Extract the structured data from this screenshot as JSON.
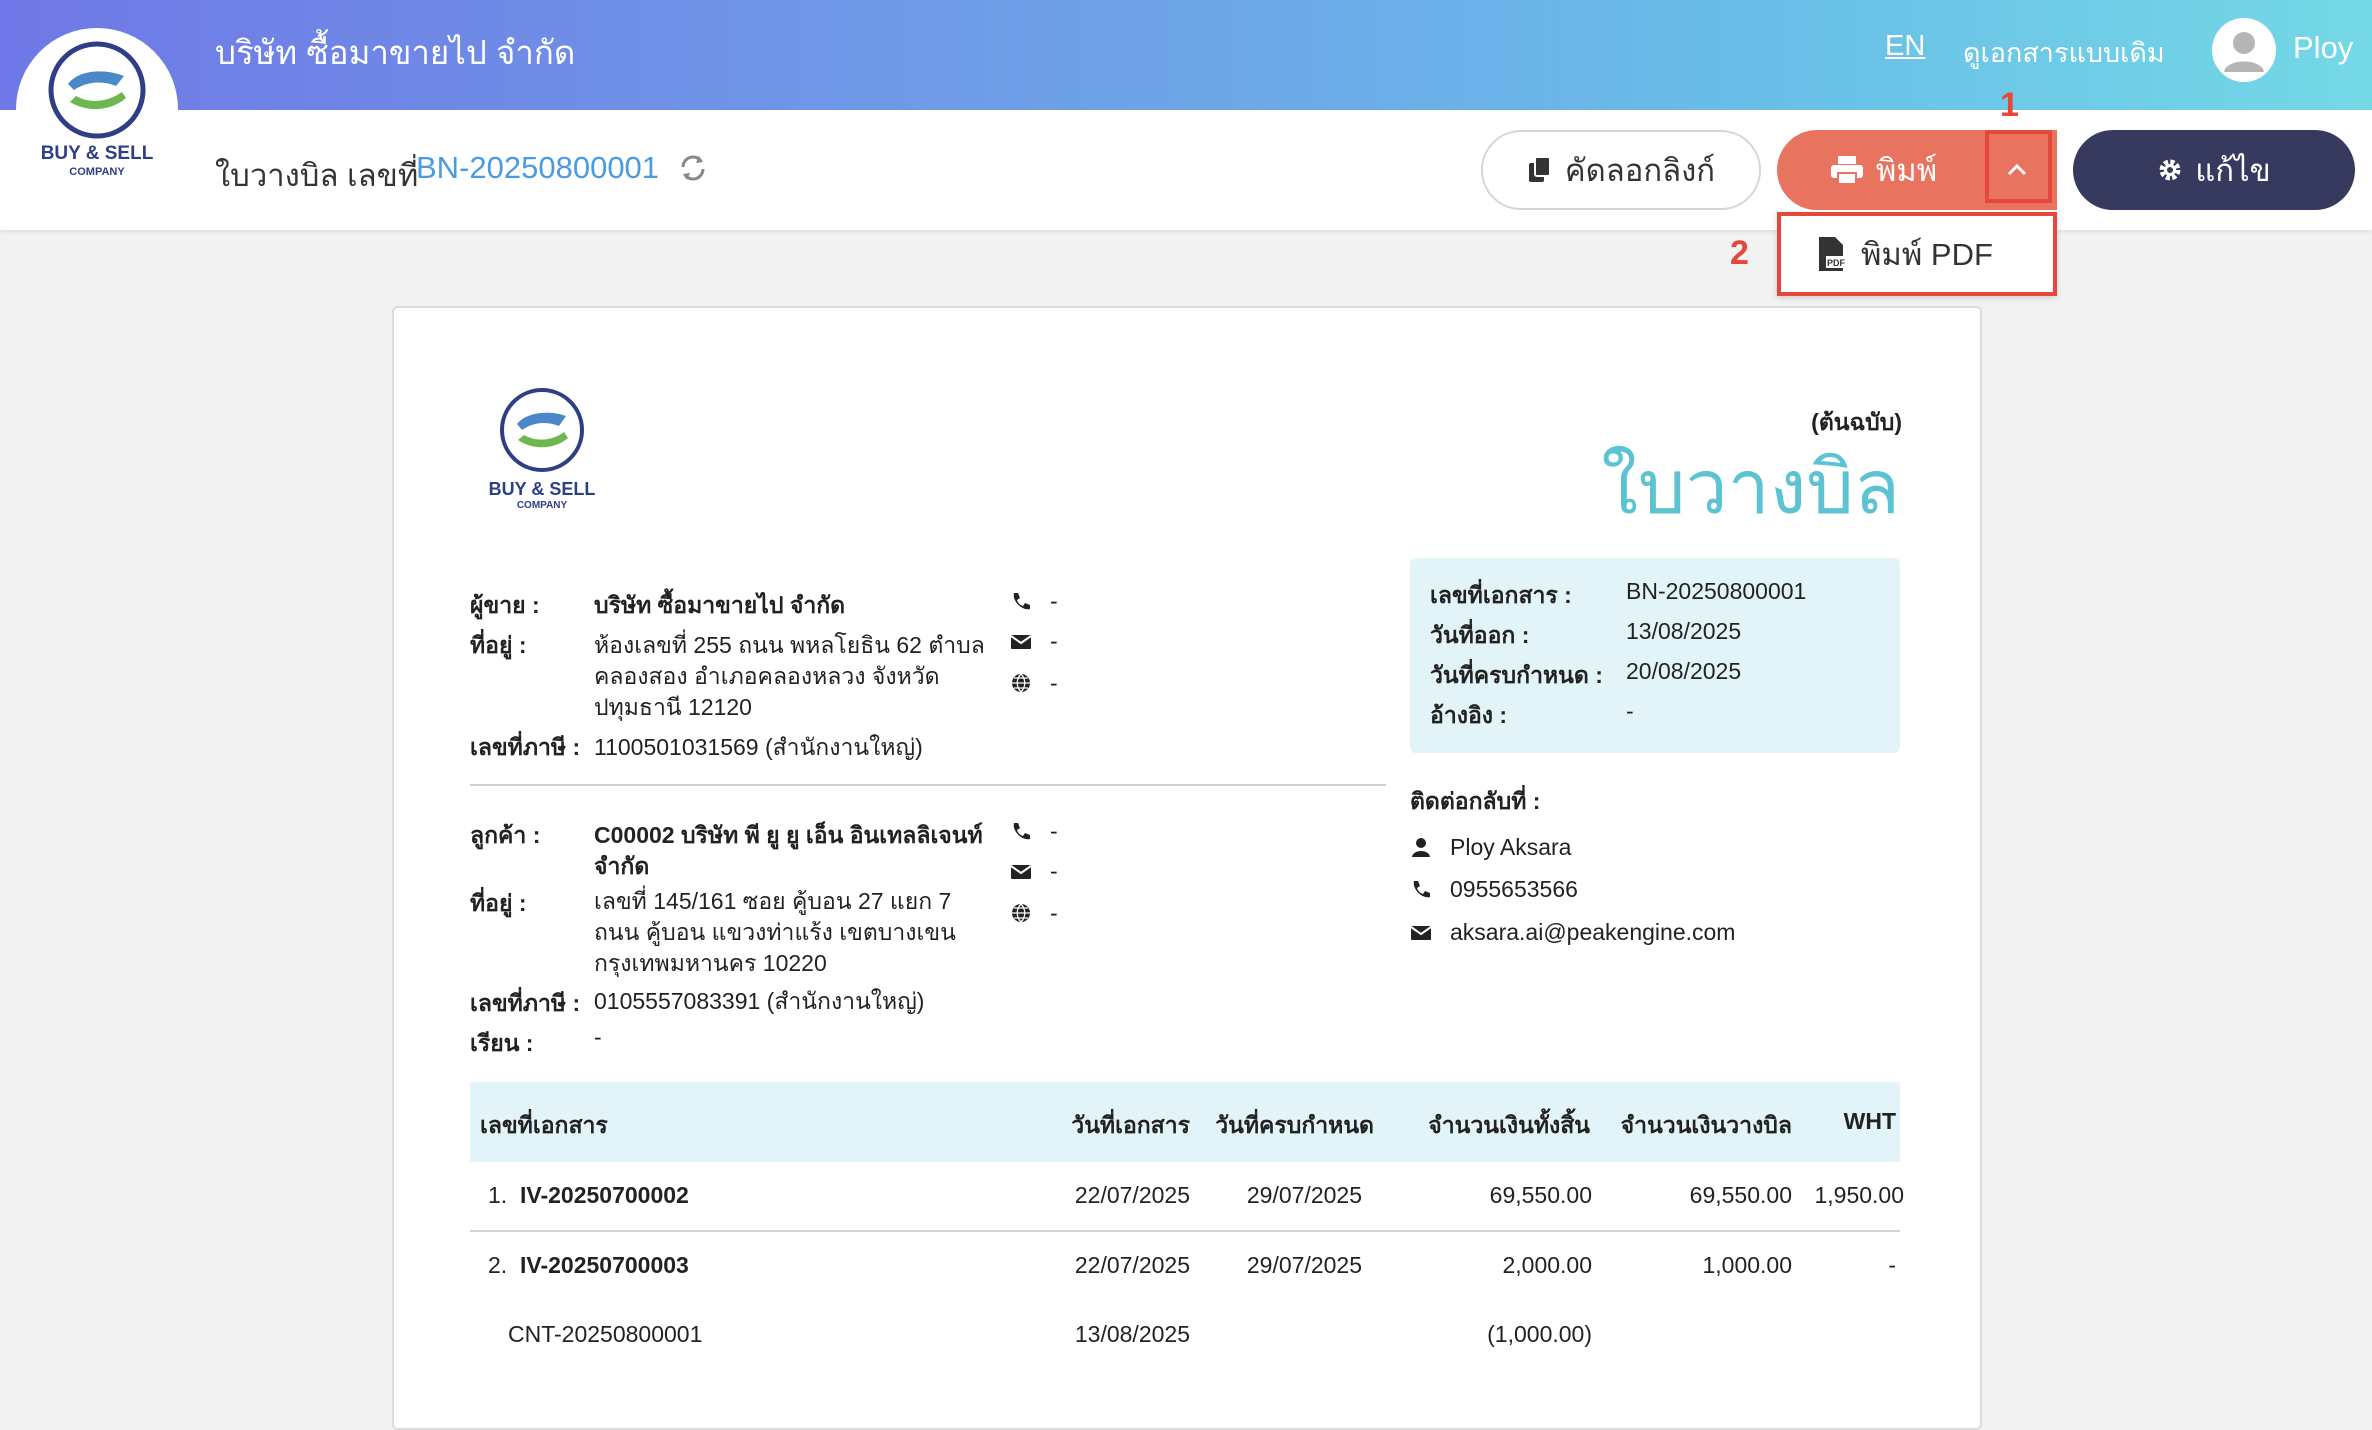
{
  "header": {
    "company_name": "บริษัท ซื้อมาขายไป จำกัด",
    "lang": "EN",
    "old_doc_view": "ดูเอกสารแบบเดิม",
    "user_name": "Ploy"
  },
  "logo": {
    "line1": "BUY & SELL",
    "line2": "COMPANY"
  },
  "subheader": {
    "doc_label": "ใบวางบิล เลขที่",
    "doc_number": "BN-20250800001",
    "copy_link": "คัดลอกลิงก์",
    "print": "พิมพ์",
    "edit": "แก้ไข",
    "print_pdf": "พิมพ์ PDF"
  },
  "annotations": {
    "n1": "1",
    "n2": "2"
  },
  "document": {
    "copy_tag": "(ต้นฉบับ)",
    "title": "ใบวางบิล",
    "seller": {
      "label": "ผู้ขาย :",
      "name": "บริษัท ซื้อมาขายไป จำกัด",
      "address_label": "ที่อยู่ :",
      "address_lines": [
        "ห้องเลขที่ 255 ถนน พหลโยธิน 62 ตำบล",
        "คลองสอง อำเภอคลองหลวง จังหวัด",
        "ปทุมธานี 12120"
      ],
      "tax_label": "เลขที่ภาษี :",
      "tax_id": "1100501031569 (สำนักงานใหญ่)",
      "phone": "-",
      "email": "-",
      "web": "-"
    },
    "customer": {
      "label": "ลูกค้า :",
      "name_lines": [
        "C00002 บริษัท พี ยู ยู เอ็น อินเทลลิเจนท์",
        "จำกัด"
      ],
      "address_label": "ที่อยู่ :",
      "address_lines": [
        "เลขที่ 145/161     ซอย คู้บอน 27 แยก 7",
        "ถนน คู้บอน  แขวงท่าแร้ง เขตบางเขน",
        "กรุงเทพมหานคร 10220"
      ],
      "tax_label": "เลขที่ภาษี :",
      "tax_id": "0105557083391 (สำนักงานใหญ่)",
      "attn_label": "เรียน :",
      "attn": "-",
      "phone": "-",
      "email": "-",
      "web": "-"
    },
    "meta": {
      "doc_no_label": "เลขที่เอกสาร :",
      "doc_no": "BN-20250800001",
      "issue_label": "วันที่ออก :",
      "issue_date": "13/08/2025",
      "due_label": "วันที่ครบกำหนด :",
      "due_date": "20/08/2025",
      "ref_label": "อ้างอิง :",
      "ref": "-"
    },
    "contact": {
      "label": "ติดต่อกลับที่ :",
      "name": "Ploy Aksara",
      "phone": "0955653566",
      "email": "aksara.ai@peakengine.com"
    },
    "table": {
      "headers": [
        "เลขที่เอกสาร",
        "วันที่เอกสาร",
        "วันที่ครบกำหนด",
        "จำนวนเงินทั้งสิ้น",
        "จำนวนเงินวางบิล",
        "WHT"
      ],
      "rows": [
        {
          "idx": "1.",
          "doc": "IV-20250700002",
          "date": "22/07/2025",
          "due": "29/07/2025",
          "total": "69,550.00",
          "billed": "69,550.00",
          "wht": "1,950.00"
        },
        {
          "idx": "2.",
          "doc": "IV-20250700003",
          "date": "22/07/2025",
          "due": "29/07/2025",
          "total": "2,000.00",
          "billed": "1,000.00",
          "wht": "-"
        },
        {
          "idx": "",
          "doc": "CNT-20250800001",
          "date": "13/08/2025",
          "due": "",
          "total": "(1,000.00)",
          "billed": "",
          "wht": ""
        }
      ]
    }
  },
  "colors": {
    "accent_red": "#e5473a",
    "print_btn": "#e8735f",
    "edit_btn": "#363a5e",
    "title_cyan": "#5bc3d2",
    "link_blue": "#4a9be2"
  }
}
